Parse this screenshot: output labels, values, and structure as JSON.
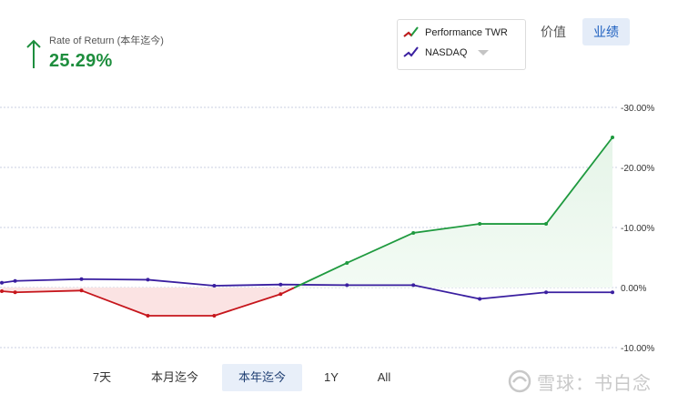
{
  "header": {
    "rate_label": "Rate of Return (本年迄今)",
    "rate_value": "25.29%",
    "rate_color": "#1e8e3e"
  },
  "legend": {
    "items": [
      {
        "label": "Performance TWR",
        "icon": "trend-line-icon"
      },
      {
        "label": "NASDAQ",
        "icon": "trend-line-icon"
      }
    ]
  },
  "view_toggle": {
    "value_label": "价值",
    "performance_label": "业绩",
    "active": "业绩"
  },
  "ranges": {
    "items": [
      "7天",
      "本月迄今",
      "本年迄今",
      "1Y",
      "All"
    ],
    "active": "本年迄今"
  },
  "watermark": {
    "text": "雪球：书白念"
  },
  "chart_data": {
    "type": "line",
    "ylim": [
      -10,
      30
    ],
    "yticks": [
      "-10.00%",
      "0.00%",
      "-10.00%",
      "-20.00%",
      "-30.00%"
    ],
    "ytick_values": [
      -10,
      0,
      10,
      20,
      30
    ],
    "grid": true,
    "series": [
      {
        "name": "Performance TWR",
        "color": "#1f9a3f",
        "x": [
          0.0,
          0.2,
          1.2,
          2.2,
          3.2,
          4.2,
          5.2,
          6.2,
          7.2,
          8.2,
          9.2
        ],
        "values": [
          -0.6,
          -0.8,
          -0.5,
          -4.7,
          -4.7,
          -1.1,
          4.1,
          9.1,
          10.6,
          10.6,
          25.0
        ]
      },
      {
        "name": "NASDAQ",
        "color": "#3a1fa0",
        "x": [
          0.0,
          0.2,
          1.2,
          2.2,
          3.2,
          4.2,
          5.2,
          6.2,
          7.2,
          8.2,
          9.2
        ],
        "values": [
          0.8,
          1.1,
          1.4,
          1.3,
          0.3,
          0.5,
          0.4,
          0.4,
          -1.9,
          -0.8,
          -0.8
        ]
      }
    ],
    "below_color": "#c6161c",
    "fill_above": "#e3f3e6",
    "fill_below": "#fbe3e3"
  }
}
